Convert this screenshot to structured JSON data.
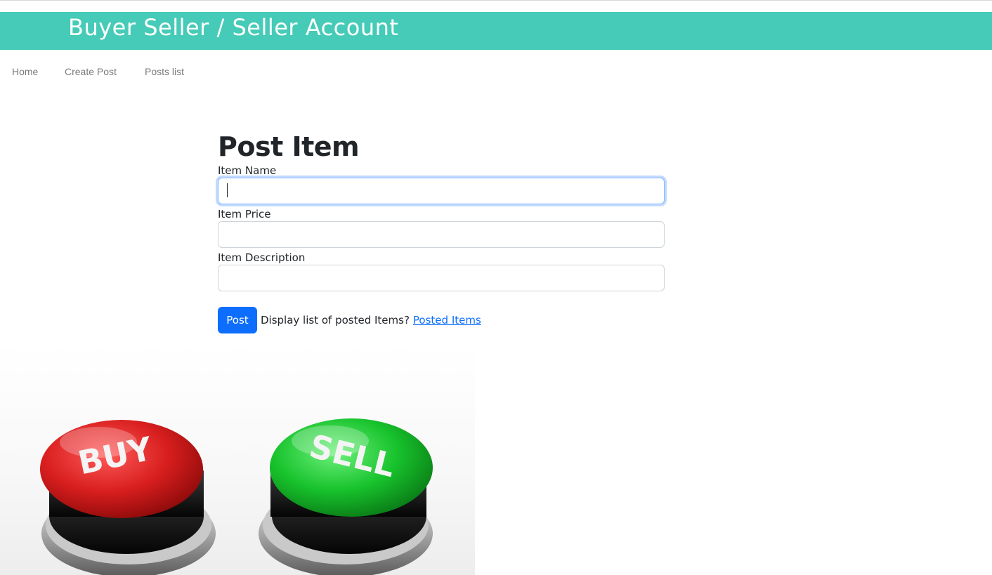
{
  "header": {
    "title": "Buyer Seller / Seller Account",
    "background_color": "#45cbb7"
  },
  "nav": {
    "items": [
      {
        "label": "Home"
      },
      {
        "label": "Create Post"
      },
      {
        "label": "Posts list"
      }
    ]
  },
  "form": {
    "title": "Post Item",
    "fields": [
      {
        "label": "Item Name",
        "value": "",
        "focused": true
      },
      {
        "label": "Item Price",
        "value": ""
      },
      {
        "label": "Item Description",
        "value": ""
      }
    ],
    "submit_label": "Post",
    "helper_text": "Display list of posted Items?",
    "link_text": "Posted Items",
    "accent_color": "#0d6efd"
  },
  "hero_image": {
    "buttons": [
      {
        "label": "BUY",
        "color": "#d81e1e"
      },
      {
        "label": "SELL",
        "color": "#17c22c"
      }
    ]
  }
}
